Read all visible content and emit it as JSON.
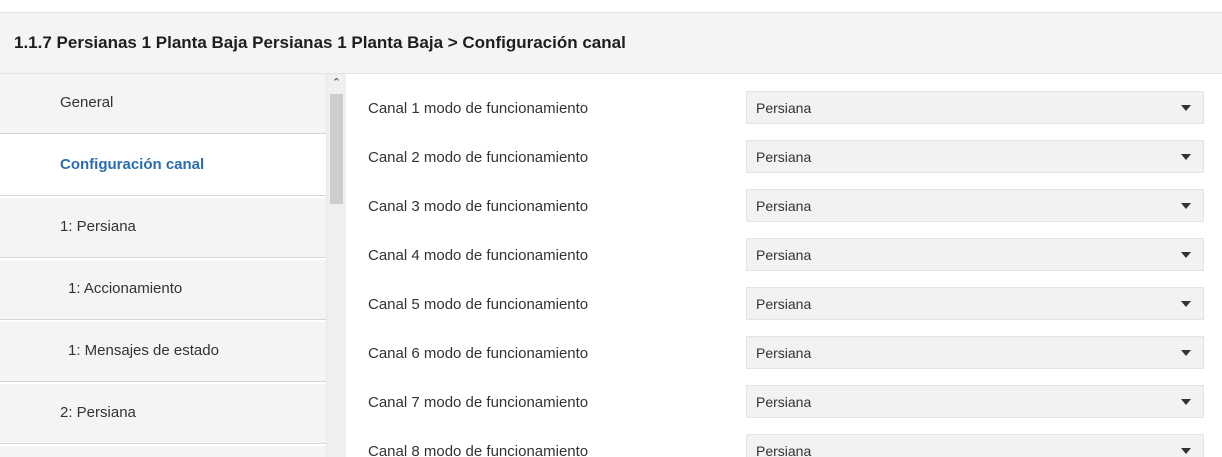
{
  "header": {
    "title": "1.1.7 Persianas 1 Planta Baja Persianas 1 Planta Baja > Configuración canal"
  },
  "sidebar": {
    "items": [
      {
        "label": "General",
        "active": false,
        "sub": false
      },
      {
        "label": "Configuración canal",
        "active": true,
        "sub": false
      },
      {
        "label": "1: Persiana",
        "active": false,
        "sub": false
      },
      {
        "label": "1: Accionamiento",
        "active": false,
        "sub": true
      },
      {
        "label": "1: Mensajes de estado",
        "active": false,
        "sub": true
      },
      {
        "label": "2: Persiana",
        "active": false,
        "sub": false
      }
    ],
    "scroll_up_icon": "chevron-up-icon"
  },
  "main": {
    "rows": [
      {
        "label": "Canal 1 modo de funcionamiento",
        "value": "Persiana"
      },
      {
        "label": "Canal 2 modo de funcionamiento",
        "value": "Persiana"
      },
      {
        "label": "Canal 3 modo de funcionamiento",
        "value": "Persiana"
      },
      {
        "label": "Canal 4 modo de funcionamiento",
        "value": "Persiana"
      },
      {
        "label": "Canal 5 modo de funcionamiento",
        "value": "Persiana"
      },
      {
        "label": "Canal 6 modo de funcionamiento",
        "value": "Persiana"
      },
      {
        "label": "Canal 7 modo de funcionamiento",
        "value": "Persiana"
      },
      {
        "label": "Canal 8 modo de funcionamiento",
        "value": "Persiana"
      }
    ],
    "dropdown_icon": "caret-down-icon"
  },
  "colors": {
    "accent": "#2b6cb0",
    "panel_bg": "#f4f4f4",
    "select_bg": "#f2f2f2"
  }
}
